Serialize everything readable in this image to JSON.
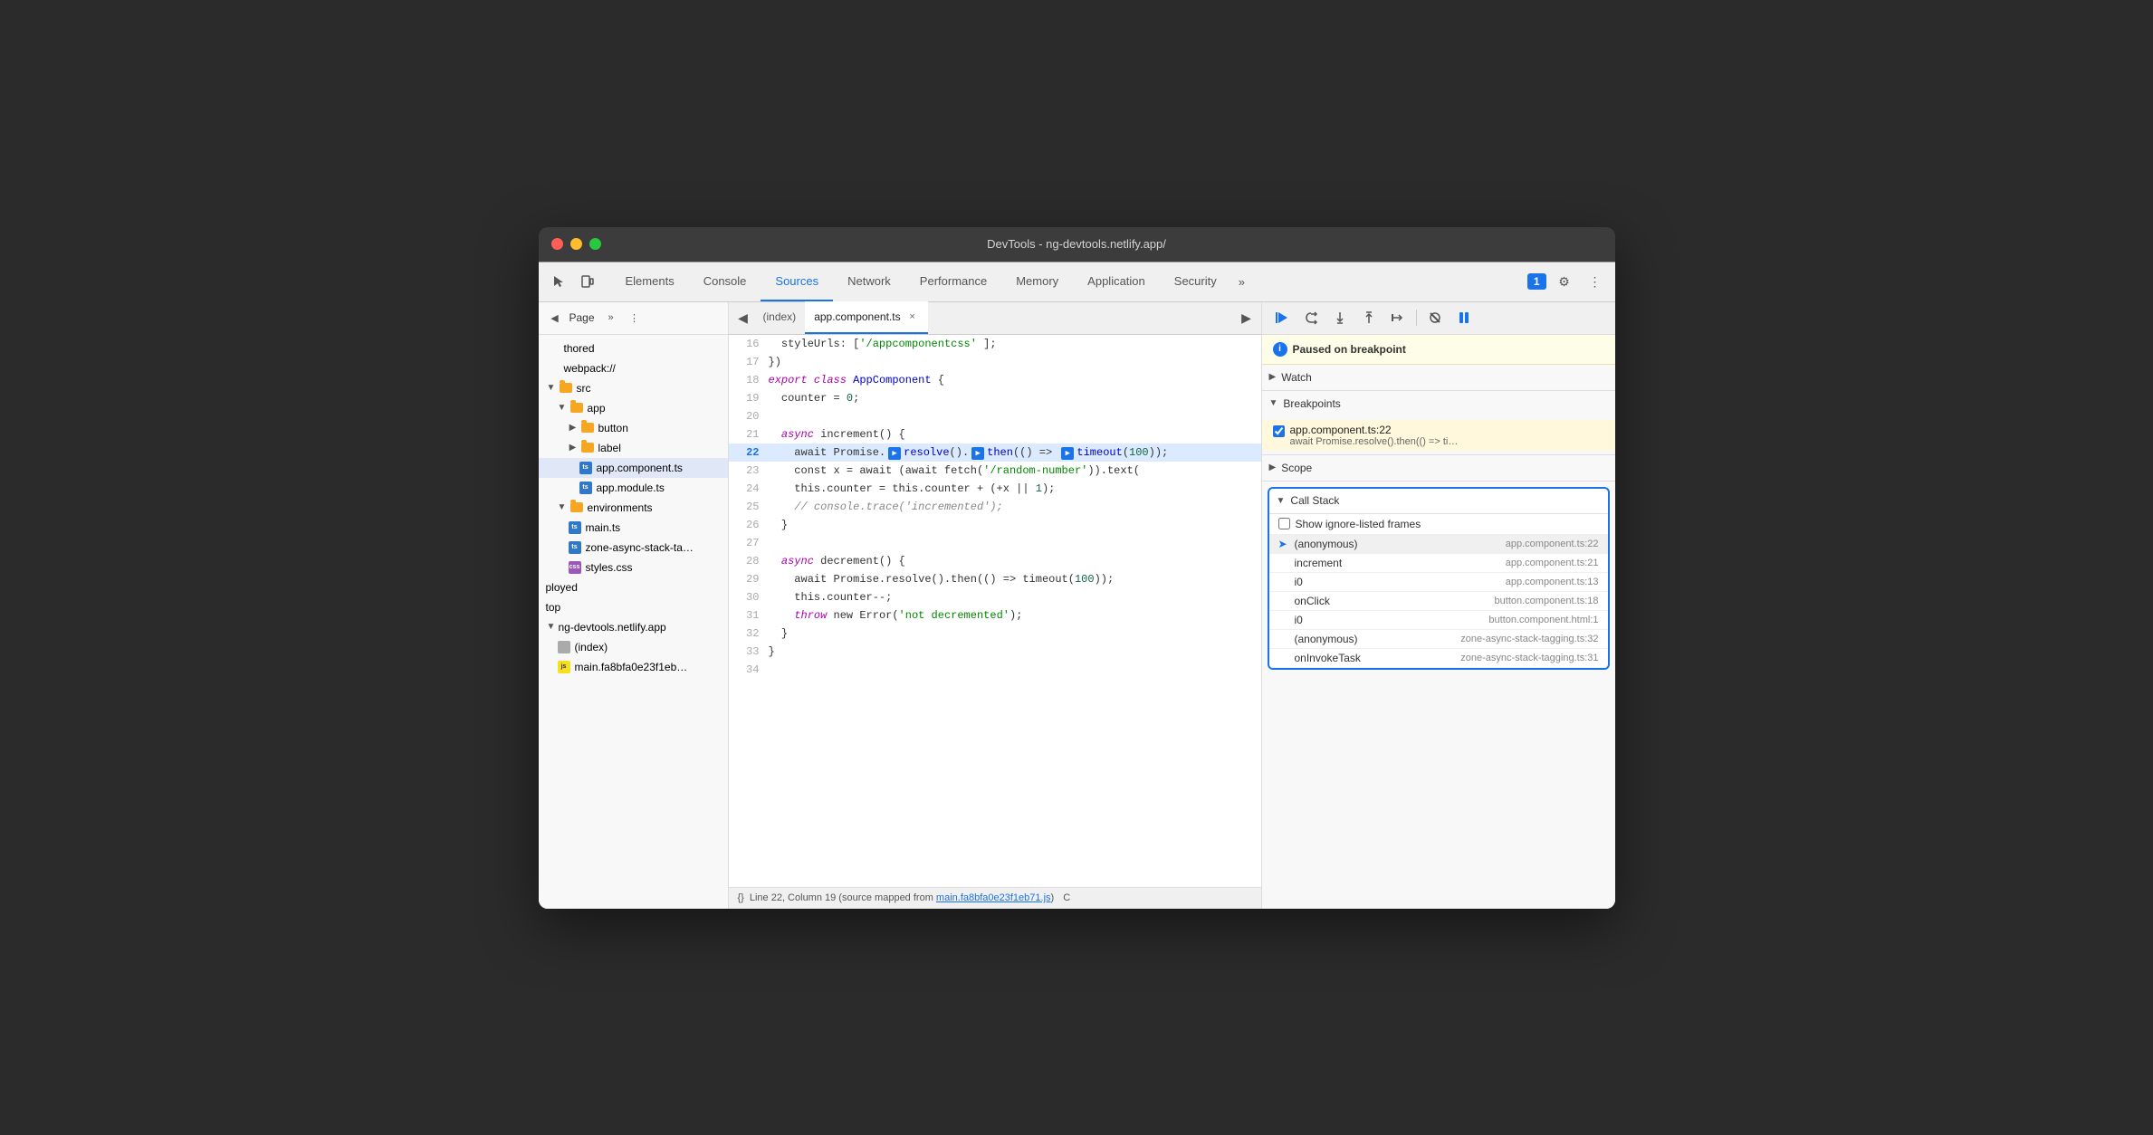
{
  "window": {
    "title": "DevTools - ng-devtools.netlify.app/"
  },
  "titlebar": {
    "close_btn": "×",
    "min_btn": "−",
    "max_btn": "+"
  },
  "toolbar": {
    "tabs": [
      {
        "label": "Elements",
        "active": false
      },
      {
        "label": "Console",
        "active": false
      },
      {
        "label": "Sources",
        "active": true
      },
      {
        "label": "Network",
        "active": false
      },
      {
        "label": "Performance",
        "active": false
      },
      {
        "label": "Memory",
        "active": false
      },
      {
        "label": "Application",
        "active": false
      },
      {
        "label": "Security",
        "active": false
      }
    ],
    "more_tabs_label": "»",
    "notification_count": "1",
    "settings_label": "⚙",
    "menu_label": "⋮"
  },
  "sidebar": {
    "header_label": "Page",
    "more_label": "»",
    "menu_label": "⋮",
    "tree": [
      {
        "id": "thored",
        "label": "thored",
        "indent": 0,
        "type": "text"
      },
      {
        "id": "webpack",
        "label": "webpack://",
        "indent": 0,
        "type": "text"
      },
      {
        "id": "src",
        "label": "src",
        "indent": 0,
        "type": "folder"
      },
      {
        "id": "app",
        "label": "app",
        "indent": 1,
        "type": "folder"
      },
      {
        "id": "button",
        "label": "button",
        "indent": 2,
        "type": "folder-collapsed"
      },
      {
        "id": "label",
        "label": "label",
        "indent": 2,
        "type": "folder-collapsed"
      },
      {
        "id": "app-component-ts",
        "label": "app.component.ts",
        "indent": 2,
        "type": "file-ts",
        "selected": true
      },
      {
        "id": "app-module-ts",
        "label": "app.module.ts",
        "indent": 2,
        "type": "file-ts"
      },
      {
        "id": "environments",
        "label": "environments",
        "indent": 1,
        "type": "folder"
      },
      {
        "id": "main-ts",
        "label": "main.ts",
        "indent": 1,
        "type": "file-ts"
      },
      {
        "id": "zone-async",
        "label": "zone-async-stack-ta…",
        "indent": 1,
        "type": "file-ts"
      },
      {
        "id": "styles-css",
        "label": "styles.css",
        "indent": 1,
        "type": "file-css"
      },
      {
        "id": "ployed",
        "label": "ployed",
        "indent": 0,
        "type": "text"
      },
      {
        "id": "top",
        "label": "top",
        "indent": 0,
        "type": "text"
      },
      {
        "id": "ng-devtools",
        "label": "ng-devtools.netlify.app",
        "indent": 0,
        "type": "text"
      },
      {
        "id": "index",
        "label": "(index)",
        "indent": 1,
        "type": "file-generic"
      },
      {
        "id": "main-fa8bfa",
        "label": "main.fa8bfa0e23f1eb…",
        "indent": 1,
        "type": "file-js"
      }
    ]
  },
  "editor": {
    "tabs": [
      {
        "label": "(index)",
        "active": false
      },
      {
        "label": "app.component.ts",
        "active": true,
        "closeable": true
      }
    ],
    "lines": [
      {
        "num": 16,
        "content_parts": [
          {
            "text": "  styleUrls: ['",
            "cls": ""
          },
          {
            "text": "/appcomponentcss",
            "cls": "str"
          },
          {
            "text": "' ];",
            "cls": ""
          }
        ],
        "raw": "  styleUrls: ['/appcomponentcss' ];"
      },
      {
        "num": 17,
        "content_parts": [
          {
            "text": "})",
            "cls": ""
          }
        ],
        "raw": "})"
      },
      {
        "num": 18,
        "content_parts": [
          {
            "text": "export ",
            "cls": "kw"
          },
          {
            "text": "class ",
            "cls": "kw"
          },
          {
            "text": "AppComponent",
            "cls": "cls"
          },
          {
            "text": " {",
            "cls": ""
          }
        ],
        "raw": "export class AppComponent {"
      },
      {
        "num": 19,
        "content_parts": [
          {
            "text": "  counter = ",
            "cls": ""
          },
          {
            "text": "0",
            "cls": "num"
          },
          {
            "text": ";",
            "cls": ""
          }
        ],
        "raw": "  counter = 0;"
      },
      {
        "num": 20,
        "content_parts": [
          {
            "text": "",
            "cls": ""
          }
        ],
        "raw": ""
      },
      {
        "num": 21,
        "content_parts": [
          {
            "text": "  ",
            "cls": ""
          },
          {
            "text": "async",
            "cls": "kw"
          },
          {
            "text": " increment() {",
            "cls": ""
          }
        ],
        "raw": "  async increment() {"
      },
      {
        "num": 22,
        "content_parts": [
          {
            "text": "    await Promise.",
            "cls": ""
          },
          {
            "text": "resolve",
            "cls": "fn"
          },
          {
            "text": "().",
            "cls": ""
          },
          {
            "text": "then",
            "cls": "fn"
          },
          {
            "text": "(() => ",
            "cls": ""
          },
          {
            "text": "timeout",
            "cls": "fn"
          },
          {
            "text": "(100));",
            "cls": ""
          }
        ],
        "raw": "    await Promise.resolve().then(() => timeout(100));",
        "breakpoint": true,
        "current": true
      },
      {
        "num": 23,
        "content_parts": [
          {
            "text": "    const x = await (await fetch('/random-number')).text(",
            "cls": ""
          }
        ],
        "raw": "    const x = await (await fetch('/random-number')).text("
      },
      {
        "num": 24,
        "content_parts": [
          {
            "text": "    this.counter = this.counter + (+x || ",
            "cls": ""
          },
          {
            "text": "1",
            "cls": "num"
          },
          {
            "text": ");",
            "cls": ""
          }
        ],
        "raw": "    this.counter = this.counter + (+x || 1);"
      },
      {
        "num": 25,
        "content_parts": [
          {
            "text": "    // console.trace('incremented');",
            "cls": "cmt"
          }
        ],
        "raw": "    // console.trace('incremented');"
      },
      {
        "num": 26,
        "content_parts": [
          {
            "text": "  }",
            "cls": ""
          }
        ],
        "raw": "  }"
      },
      {
        "num": 27,
        "content_parts": [
          {
            "text": "",
            "cls": ""
          }
        ],
        "raw": ""
      },
      {
        "num": 28,
        "content_parts": [
          {
            "text": "  ",
            "cls": ""
          },
          {
            "text": "async",
            "cls": "kw"
          },
          {
            "text": " decrement() {",
            "cls": ""
          }
        ],
        "raw": "  async decrement() {"
      },
      {
        "num": 29,
        "content_parts": [
          {
            "text": "    await Promise.resolve().then(() => timeout(",
            "cls": ""
          },
          {
            "text": "100",
            "cls": "num"
          },
          {
            "text": "));",
            "cls": ""
          }
        ],
        "raw": "    await Promise.resolve().then(() => timeout(100));"
      },
      {
        "num": 30,
        "content_parts": [
          {
            "text": "    this.counter--;",
            "cls": ""
          }
        ],
        "raw": "    this.counter--;"
      },
      {
        "num": 31,
        "content_parts": [
          {
            "text": "    ",
            "cls": ""
          },
          {
            "text": "throw",
            "cls": "kw"
          },
          {
            "text": " new Error(",
            "cls": ""
          },
          {
            "text": "'not decremented'",
            "cls": "str"
          },
          {
            "text": ");",
            "cls": ""
          }
        ],
        "raw": "    throw new Error('not decremented');"
      },
      {
        "num": 32,
        "content_parts": [
          {
            "text": "  }",
            "cls": ""
          }
        ],
        "raw": "  }"
      },
      {
        "num": 33,
        "content_parts": [
          {
            "text": "}",
            "cls": ""
          }
        ],
        "raw": "}"
      },
      {
        "num": 34,
        "content_parts": [
          {
            "text": "",
            "cls": ""
          }
        ],
        "raw": ""
      }
    ],
    "status_bar": "Line 22, Column 19 (source mapped from main.fa8bfa0e23f1eb71.js)",
    "status_file": "main.fa8bfa0e23f1eb71.js"
  },
  "debugger": {
    "toolbar": {
      "resume_label": "▶",
      "step_over_label": "↺",
      "step_into_label": "↓",
      "step_out_label": "↑",
      "step_label": "→",
      "deactivate_label": "/",
      "pause_label": "⏸"
    },
    "breakpoint_notice": "Paused on breakpoint",
    "sections": {
      "watch": {
        "label": "Watch",
        "collapsed": true
      },
      "breakpoints": {
        "label": "Breakpoints",
        "expanded": true,
        "items": [
          {
            "file": "app.component.ts:22",
            "code": "await Promise.resolve().then(() => ti…",
            "checked": true
          }
        ]
      },
      "scope": {
        "label": "Scope",
        "collapsed": true
      },
      "call_stack": {
        "label": "Call Stack",
        "expanded": true,
        "show_ignore_frames": "Show ignore-listed frames",
        "frames": [
          {
            "name": "(anonymous)",
            "location": "app.component.ts:22",
            "current": true
          },
          {
            "name": "increment",
            "location": "app.component.ts:21",
            "current": false
          },
          {
            "name": "i0",
            "location": "app.component.ts:13",
            "current": false
          },
          {
            "name": "onClick",
            "location": "button.component.ts:18",
            "current": false
          },
          {
            "name": "i0",
            "location": "button.component.html:1",
            "current": false
          },
          {
            "name": "(anonymous)",
            "location": "zone-async-stack-tagging.ts:32",
            "current": false
          },
          {
            "name": "onInvokeTask",
            "location": "zone-async-stack-tagging.ts:31",
            "current": false
          }
        ]
      }
    }
  }
}
